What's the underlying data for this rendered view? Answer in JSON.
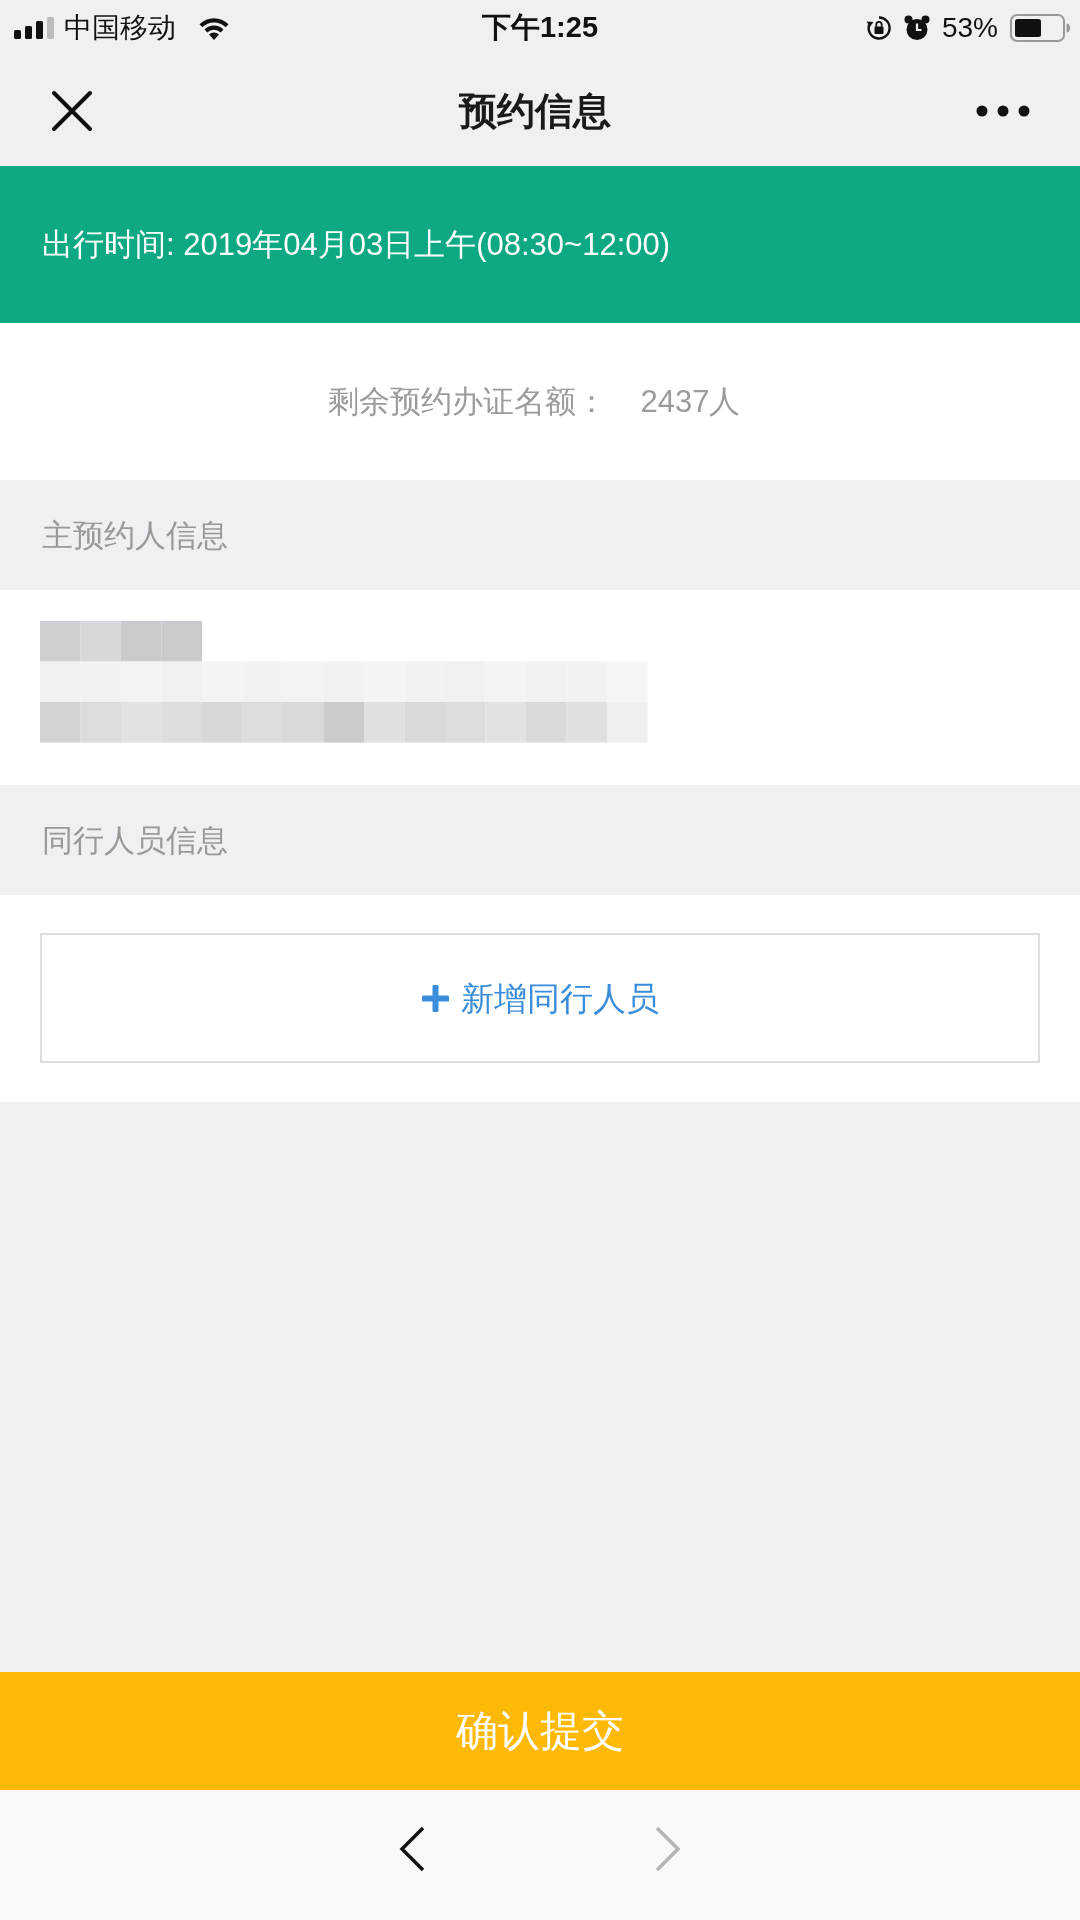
{
  "status_bar": {
    "carrier": "中国移动",
    "time": "下午1:25",
    "battery": "53%"
  },
  "nav_bar": {
    "title": "预约信息"
  },
  "banner": {
    "text": "出行时间: 2019年04月03日上午(08:30~12:00)"
  },
  "quota": {
    "label": "剩余预约办证名额：",
    "value": "2437人"
  },
  "main_applicant": {
    "title": "主预约人信息"
  },
  "companions": {
    "title": "同行人员信息",
    "add_button": "新增同行人员"
  },
  "submit_button": "确认提交",
  "toolbar": {
    "back": {
      "disabled": false
    },
    "forward": {
      "disabled": true
    }
  }
}
